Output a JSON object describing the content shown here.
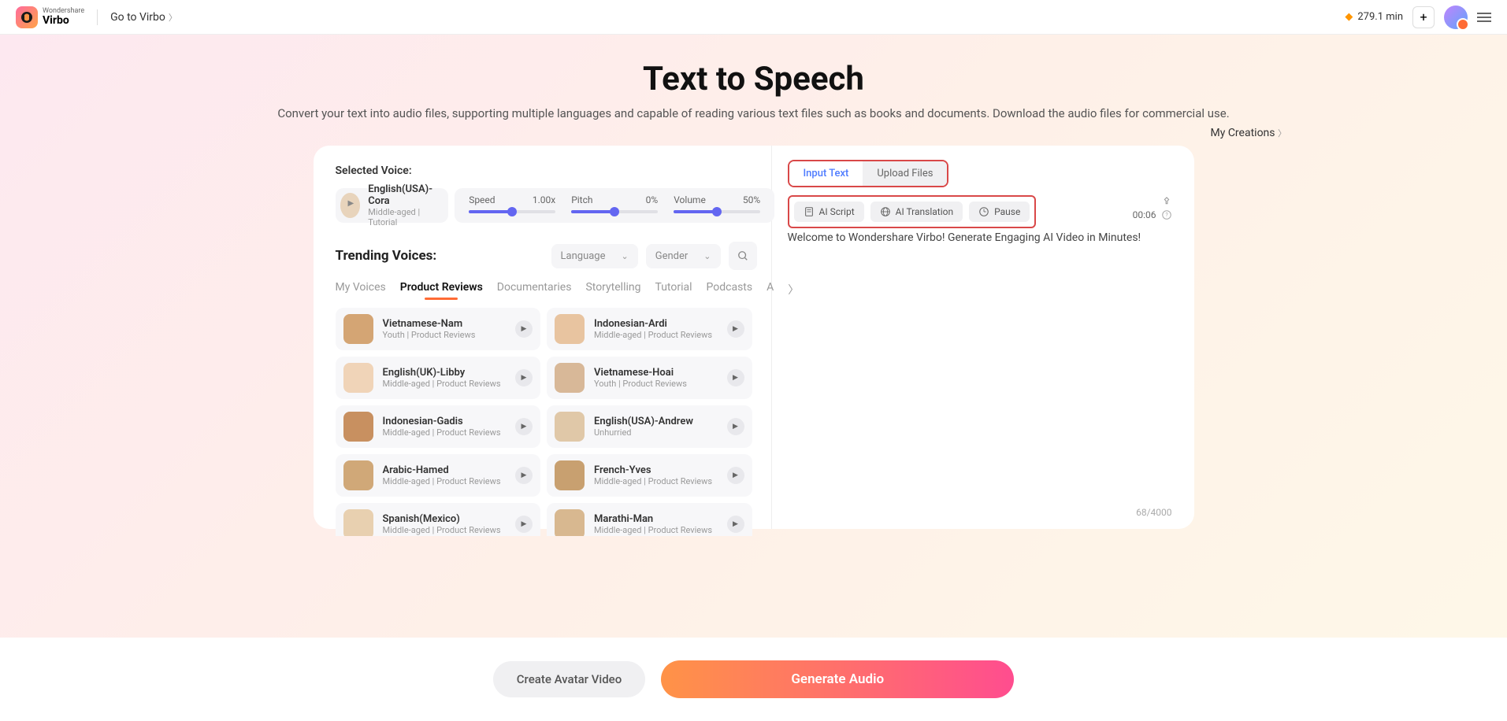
{
  "brand": {
    "top": "Wondershare",
    "name": "Virbo"
  },
  "nav": {
    "goto": "Go to Virbo",
    "minutes": "279.1 min"
  },
  "header": {
    "title": "Text to Speech",
    "subtitle": "Convert your text into audio files, supporting multiple languages and capable of reading various text files such as books and documents. Download the audio files for commercial use.",
    "my_creations": "My Creations"
  },
  "selected": {
    "label": "Selected Voice:",
    "name": "English(USA)-Cora",
    "tags": "Middle-aged | Tutorial",
    "sliders": {
      "speed": {
        "label": "Speed",
        "value": "1.00x",
        "pct": 50
      },
      "pitch": {
        "label": "Pitch",
        "value": "0%",
        "pct": 50
      },
      "volume": {
        "label": "Volume",
        "value": "50%",
        "pct": 50
      }
    }
  },
  "trending": {
    "title": "Trending Voices:",
    "filter_language": "Language",
    "filter_gender": "Gender"
  },
  "categories": [
    "My Voices",
    "Product Reviews",
    "Documentaries",
    "Storytelling",
    "Tutorial",
    "Podcasts",
    "A"
  ],
  "active_category_index": 1,
  "voices": [
    {
      "name": "Vietnamese-Nam",
      "tags": "Youth | Product Reviews"
    },
    {
      "name": "Indonesian-Ardi",
      "tags": "Middle-aged | Product Reviews"
    },
    {
      "name": "English(UK)-Libby",
      "tags": "Middle-aged | Product Reviews"
    },
    {
      "name": "Vietnamese-Hoai",
      "tags": "Youth | Product Reviews"
    },
    {
      "name": "Indonesian-Gadis",
      "tags": "Middle-aged | Product Reviews"
    },
    {
      "name": "English(USA)-Andrew",
      "tags": "Unhurried"
    },
    {
      "name": "Arabic-Hamed",
      "tags": "Middle-aged | Product Reviews"
    },
    {
      "name": "French-Yves",
      "tags": "Middle-aged | Product Reviews"
    },
    {
      "name": "Spanish(Mexico)",
      "tags": "Middle-aged | Product Reviews"
    },
    {
      "name": "Marathi-Man",
      "tags": "Middle-aged | Product Reviews"
    }
  ],
  "input": {
    "tab_text": "Input Text",
    "tab_upload": "Upload Files",
    "tool_script": "AI Script",
    "tool_translate": "AI Translation",
    "tool_pause": "Pause",
    "duration": "00:06",
    "content": "Welcome to Wondershare Virbo! Generate Engaging AI Video in Minutes!",
    "char_count": "68/4000"
  },
  "footer": {
    "create_avatar": "Create Avatar Video",
    "generate": "Generate Audio"
  }
}
